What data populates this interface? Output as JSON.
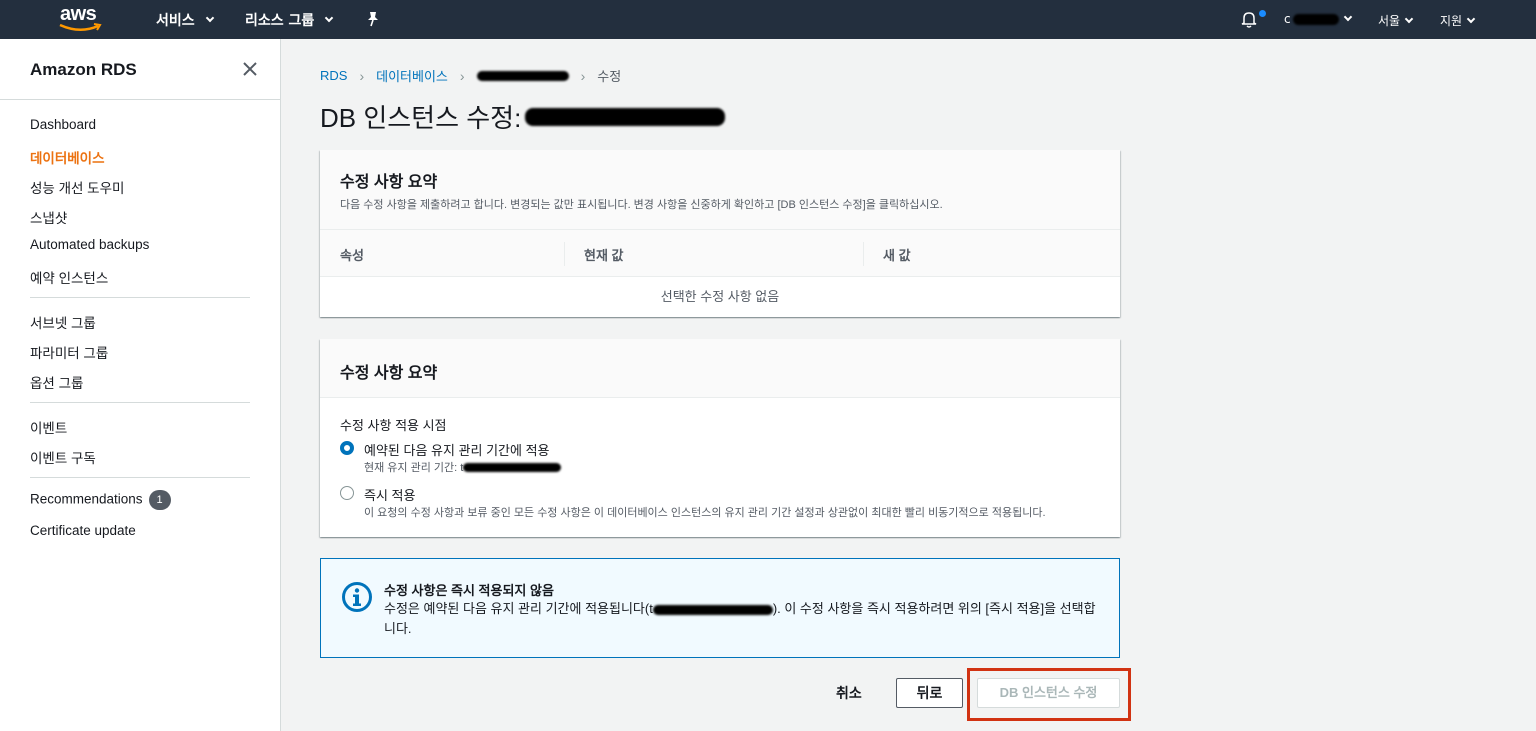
{
  "topnav": {
    "logo": "aws",
    "services": "서비스",
    "resource_groups": "리소스 그룹",
    "region": "서울",
    "support": "지원",
    "account_initial": "c"
  },
  "sidebar": {
    "title": "Amazon RDS",
    "items": [
      {
        "label": "Dashboard"
      },
      {
        "label": "데이터베이스",
        "active": true
      },
      {
        "label": "성능 개선 도우미"
      },
      {
        "label": "스냅샷"
      },
      {
        "label": "Automated backups"
      },
      {
        "label": "예약 인스턴스"
      },
      {
        "label": "서브넷 그룹"
      },
      {
        "label": "파라미터 그룹"
      },
      {
        "label": "옵션 그룹"
      },
      {
        "label": "이벤트"
      },
      {
        "label": "이벤트 구독"
      },
      {
        "label": "Recommendations",
        "badge": "1"
      },
      {
        "label": "Certificate update"
      }
    ]
  },
  "breadcrumb": {
    "root": "RDS",
    "databases": "데이터베이스",
    "current": "수정"
  },
  "page": {
    "title": "DB 인스턴스 수정:"
  },
  "summary_panel": {
    "title": "수정 사항 요약",
    "description": "다음 수정 사항을 제출하려고 합니다. 변경되는 값만 표시됩니다. 변경 사항을 신중하게 확인하고 [DB 인스턴스 수정]을 클릭하십시오.",
    "columns": [
      "속성",
      "현재 값",
      "새 값"
    ],
    "empty_text": "선택한 수정 사항 없음"
  },
  "schedule_panel": {
    "title": "수정 사항 요약",
    "field_label": "수정 사항 적용 시점",
    "option_scheduled": "예약된 다음 유지 관리 기간에 적용",
    "option_scheduled_desc": "현재 유지 관리 기간: t",
    "option_immediate": "즉시 적용",
    "option_immediate_desc": "이 요청의 수정 사항과 보류 중인 모든 수정 사항은 이 데이터베이스 인스턴스의 유지 관리 기간 설정과 상관없이 최대한 빨리 비동기적으로 적용됩니다.",
    "selected": "scheduled"
  },
  "info_alert": {
    "title": "수정 사항은 즉시 적용되지 않음",
    "text_before": "수정은 예약된 다음 유지 관리 기간에 적용됩니다(t",
    "text_after": "). 이 수정 사항을 즉시 적용하려면 위의 [즉시 적용]을 선택합니다."
  },
  "actions": {
    "cancel": "취소",
    "back": "뒤로",
    "submit": "DB 인스턴스 수정"
  },
  "colors": {
    "nav_bg": "#232f3e",
    "active": "#ec7211",
    "link": "#0073bb",
    "highlight": "#d13212"
  }
}
